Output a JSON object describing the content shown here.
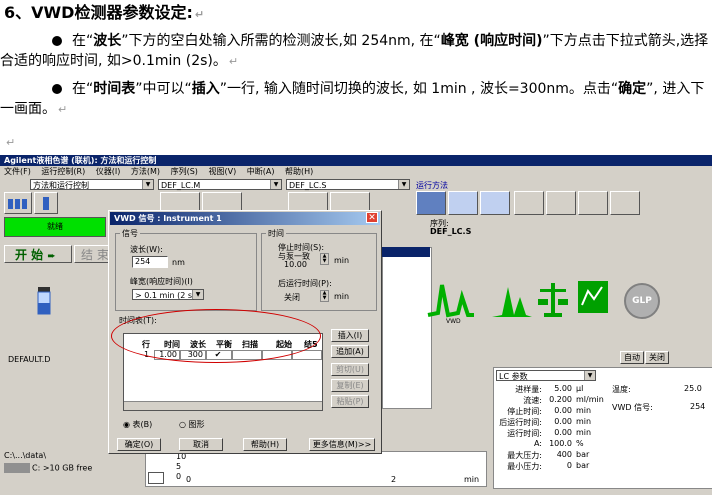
{
  "doc": {
    "heading": "6、VWD检测器参数设定:",
    "para1": {
      "p1": "在“",
      "b1": "波长",
      "p2": "”下方的空白处输入所需的检测波长,如 254nm, 在“",
      "b2": "峰宽 (响应时间)",
      "p3": "”下方点击下拉式箭头,选择合适的响应时间, 如>0.1min (2s)。"
    },
    "para2": {
      "p1": "在“",
      "b1": "时间表",
      "p2": "”中可以“",
      "b2": "插入",
      "p3": "”一行, 输入随时间切换的波长, 如 1min , 波长=300nm。点击“",
      "b3": "确定",
      "p4": "”, 进入下一画面。"
    },
    "return_mark": "↵"
  },
  "app": {
    "title": "Agilent液相色谱 (联机): 方法和运行控制",
    "menu": [
      "文件(F)",
      "运行控制(R)",
      "仪器(I)",
      "方法(M)",
      "序列(S)",
      "视图(V)",
      "中断(A)",
      "帮助(H)"
    ],
    "view_combo": "方法和运行控制",
    "method_combo": "DEF_LC.M",
    "sequence_combo": "DEF_LC.S",
    "run_method_label": "运行方法",
    "green_status": "就绪",
    "start_label": "开 始",
    "stop_label": "结 束",
    "sequence_label": "序列:",
    "sequence_name": "DEF_LC.S",
    "method_file": "DEFAULT.D",
    "path": "C:\\...\\data\\",
    "drive": "C: >10 GB free",
    "auto_label": "自动",
    "close_label": "关闭",
    "glp_label": "GLP",
    "axis_ticks": [
      "10",
      "5",
      "0"
    ],
    "x_ticks": [
      "0",
      "2",
      "min"
    ]
  },
  "lc_params": {
    "header": "LC 参数",
    "rows": [
      {
        "k": "进样量:",
        "v": "5.00",
        "u": "µl"
      },
      {
        "k": "流速:",
        "v": "0.200",
        "u": "ml/min"
      },
      {
        "k": "停止时间:",
        "v": "0.00",
        "u": "min"
      },
      {
        "k": "后运行时间:",
        "v": "0.00",
        "u": "min"
      },
      {
        "k": "运行时间:",
        "v": "0.00",
        "u": "min"
      },
      {
        "k": "A:",
        "v": "100.0",
        "u": "%"
      },
      {
        "k": "最大压力:",
        "v": "400",
        "u": "bar"
      },
      {
        "k": "最小压力:",
        "v": "0",
        "u": "bar"
      }
    ],
    "temp_label": "温度:",
    "temp_value": "25.0",
    "vwd_label": "VWD 信号:",
    "vwd_value": "254"
  },
  "dialog": {
    "title": "VWD 信号 : Instrument 1",
    "signal_group": "信号",
    "wavelength_label": "波长(W):",
    "wavelength_value": "254",
    "wavelength_unit": "nm",
    "peakwidth_label": "峰宽(响应时间)(I)",
    "peakwidth_value": "> 0.1 min  (2 s)",
    "time_group": "时间",
    "stoptime_label": "停止时间(S):",
    "stoptime_sub": "与泵一致",
    "stoptime_value": "10.00",
    "stoptime_unit": "min",
    "posttime_label": "后运行时间(P):",
    "posttime_value": "关闭",
    "posttime_unit": "min",
    "timetable_label": "时间表(T):",
    "table_headers": [
      "行",
      "时间",
      "波长",
      "平衡",
      "扫描",
      "起始",
      "结5"
    ],
    "table_row": {
      "row": "1",
      "time": "1.00",
      "wl": "300",
      "balance": "✔"
    },
    "insert_btn": "插入(I)",
    "append_btn": "追加(A)",
    "cut_btn": "剪切(U)",
    "copy_btn": "复制(E)",
    "paste_btn": "粘贴(P)",
    "radio_table": "表(B)",
    "radio_graph": "图形",
    "ok_btn": "确定(O)",
    "cancel_btn": "取消",
    "help_btn": "帮助(H)",
    "more_btn": "更多信息(M)>>"
  }
}
